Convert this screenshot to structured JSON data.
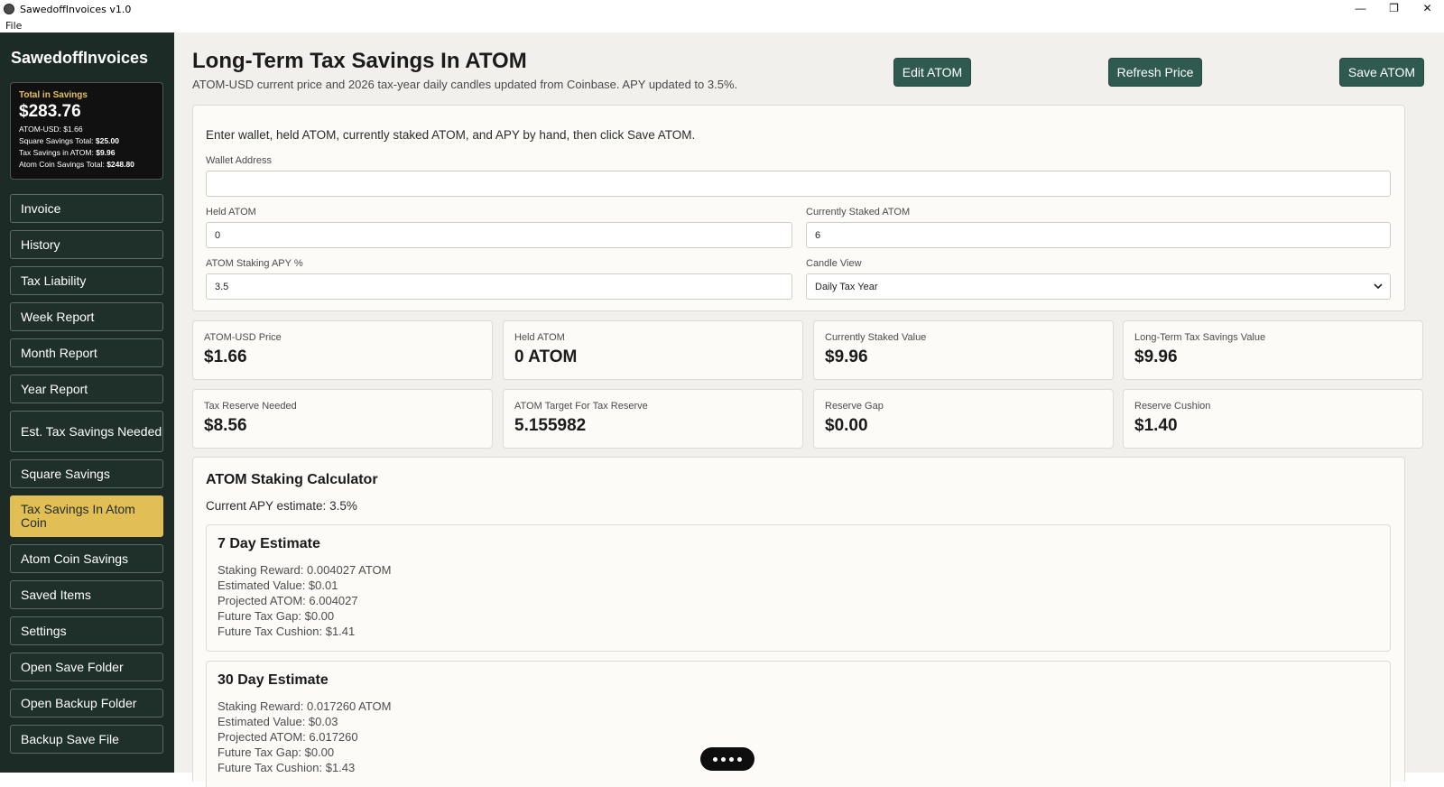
{
  "window": {
    "title": "SawedoffInvoices v1.0",
    "menu": [
      "File"
    ],
    "controls": {
      "minimize": "—",
      "restore": "❐",
      "close": "✕"
    }
  },
  "sidebar": {
    "brand": "SawedoffInvoices",
    "summary": {
      "label": "Total in Savings",
      "total": "$283.76",
      "lines": [
        {
          "label": "ATOM-USD:",
          "value": "$1.66"
        },
        {
          "label": "Square Savings Total:",
          "value": "$25.00"
        },
        {
          "label": "Tax Savings in ATOM:",
          "value": "$9.96"
        },
        {
          "label": "Atom Coin Savings Total:",
          "value": "$248.80"
        }
      ]
    },
    "items": [
      {
        "label": "Invoice"
      },
      {
        "label": "History"
      },
      {
        "label": "Tax Liability"
      },
      {
        "label": "Week Report"
      },
      {
        "label": "Month Report"
      },
      {
        "label": "Year Report"
      },
      {
        "label": "Est. Tax Savings Needed"
      },
      {
        "label": "Square Savings"
      },
      {
        "label": "Tax Savings In Atom Coin"
      },
      {
        "label": "Atom Coin Savings"
      },
      {
        "label": "Saved Items"
      },
      {
        "label": "Settings"
      },
      {
        "label": "Open Save Folder"
      },
      {
        "label": "Open Backup Folder"
      },
      {
        "label": "Backup Save File"
      }
    ],
    "active_item": "Tax Savings In Atom Coin"
  },
  "header": {
    "title": "Long-Term Tax Savings In ATOM",
    "subtitle": "ATOM-USD current price and 2026 tax-year daily candles updated from Coinbase. APY updated to 3.5%.",
    "buttons": {
      "edit": "Edit ATOM",
      "refresh": "Refresh Price",
      "save": "Save ATOM"
    }
  },
  "form": {
    "intro": "Enter wallet, held ATOM, currently staked ATOM, and APY by hand, then click Save ATOM.",
    "wallet": {
      "label": "Wallet Address",
      "value": ""
    },
    "held": {
      "label": "Held ATOM",
      "value": "0"
    },
    "staked": {
      "label": "Currently Staked ATOM",
      "value": "6"
    },
    "apy": {
      "label": "ATOM Staking APY %",
      "value": "3.5"
    },
    "candle": {
      "label": "Candle View",
      "value": "Daily Tax Year"
    }
  },
  "stats": [
    {
      "label": "ATOM-USD Price",
      "value": "$1.66"
    },
    {
      "label": "Held ATOM",
      "value": "0 ATOM"
    },
    {
      "label": "Currently Staked Value",
      "value": "$9.96"
    },
    {
      "label": "Long-Term Tax Savings Value",
      "value": "$9.96"
    },
    {
      "label": "Tax Reserve Needed",
      "value": "$8.56"
    },
    {
      "label": "ATOM Target For Tax Reserve",
      "value": "5.155982"
    },
    {
      "label": "Reserve Gap",
      "value": "$0.00"
    },
    {
      "label": "Reserve Cushion",
      "value": "$1.40"
    }
  ],
  "calculator": {
    "title": "ATOM Staking Calculator",
    "apy_text": "Current APY estimate: 3.5%",
    "estimates": [
      {
        "title": "7 Day Estimate",
        "lines": [
          "Staking Reward: 0.004027 ATOM",
          "Estimated Value: $0.01",
          "Projected ATOM: 6.004027",
          "Future Tax Gap: $0.00",
          "Future Tax Cushion: $1.41"
        ]
      },
      {
        "title": "30 Day Estimate",
        "lines": [
          "Staking Reward: 0.017260 ATOM",
          "Estimated Value: $0.03",
          "Projected ATOM: 6.017260",
          "Future Tax Gap: $0.00",
          "Future Tax Cushion: $1.43"
        ]
      }
    ]
  },
  "colors": {
    "sidebar_bg": "#1c2b26",
    "active_nav": "#e2bf55",
    "button": "#2e5a4f",
    "summary_label": "#e2c15d"
  }
}
